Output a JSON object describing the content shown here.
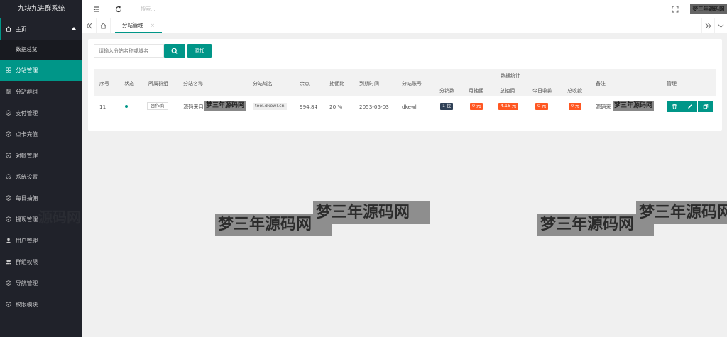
{
  "app": {
    "title": "九块九进群系统"
  },
  "sidebar": {
    "home_label": "主页",
    "home_sub": "数据总览",
    "items": [
      {
        "label": "分站管理",
        "icon": "grid-icon",
        "active": true
      },
      {
        "label": "分站群组",
        "icon": "sliders-icon"
      },
      {
        "label": "支付管理",
        "icon": "shield-icon"
      },
      {
        "label": "点卡充值",
        "icon": "shield-icon"
      },
      {
        "label": "对帐管理",
        "icon": "shield-icon"
      },
      {
        "label": "系统设置",
        "icon": "shield-icon"
      },
      {
        "label": "每日抽佣",
        "icon": "shield-icon"
      },
      {
        "label": "提现管理",
        "icon": "shield-icon"
      },
      {
        "label": "用户管理",
        "icon": "user-icon"
      },
      {
        "label": "群组权限",
        "icon": "users-icon"
      },
      {
        "label": "导航管理",
        "icon": "shield-icon"
      },
      {
        "label": "权限模块",
        "icon": "shield-icon"
      }
    ]
  },
  "topbar": {
    "search_placeholder": "搜索...",
    "user": "梦三年源码网"
  },
  "tabs": {
    "active_label": "分站管理",
    "close": "×"
  },
  "toolbar": {
    "search_placeholder": "请输入分站名称或域名",
    "add_label": "添加"
  },
  "table": {
    "headers": {
      "id": "序号",
      "status": "状态",
      "group": "所属群组",
      "name": "分站名称",
      "domain": "分站域名",
      "balance": "余点",
      "ratio": "抽佣比",
      "expire": "到期时间",
      "account": "分站账号",
      "stats": "数据统计",
      "sub_count": "分销数",
      "month": "月抽佣",
      "total_comm": "总抽佣",
      "today": "今日收款",
      "total_recv": "总收款",
      "remark": "备注",
      "manage": "管理"
    },
    "row": {
      "id": "11",
      "group": "合作商",
      "name": "源码来自",
      "domain": "tool.dkewl.cn",
      "balance": "994.84",
      "ratio": "20 %",
      "expire": "2053-05-03",
      "account": "dkewl",
      "sub_count": "1 位",
      "month": "0 元",
      "total_comm": "4.16 元",
      "today": "0 元",
      "total_recv": "0 元",
      "remark": "源码来"
    }
  },
  "watermark": {
    "text": "梦三年源码网",
    "faint": "源码网"
  },
  "colors": {
    "accent": "#009688",
    "sidebar": "#20222a",
    "orange": "#ff5722",
    "dark_badge": "#2f4056"
  }
}
